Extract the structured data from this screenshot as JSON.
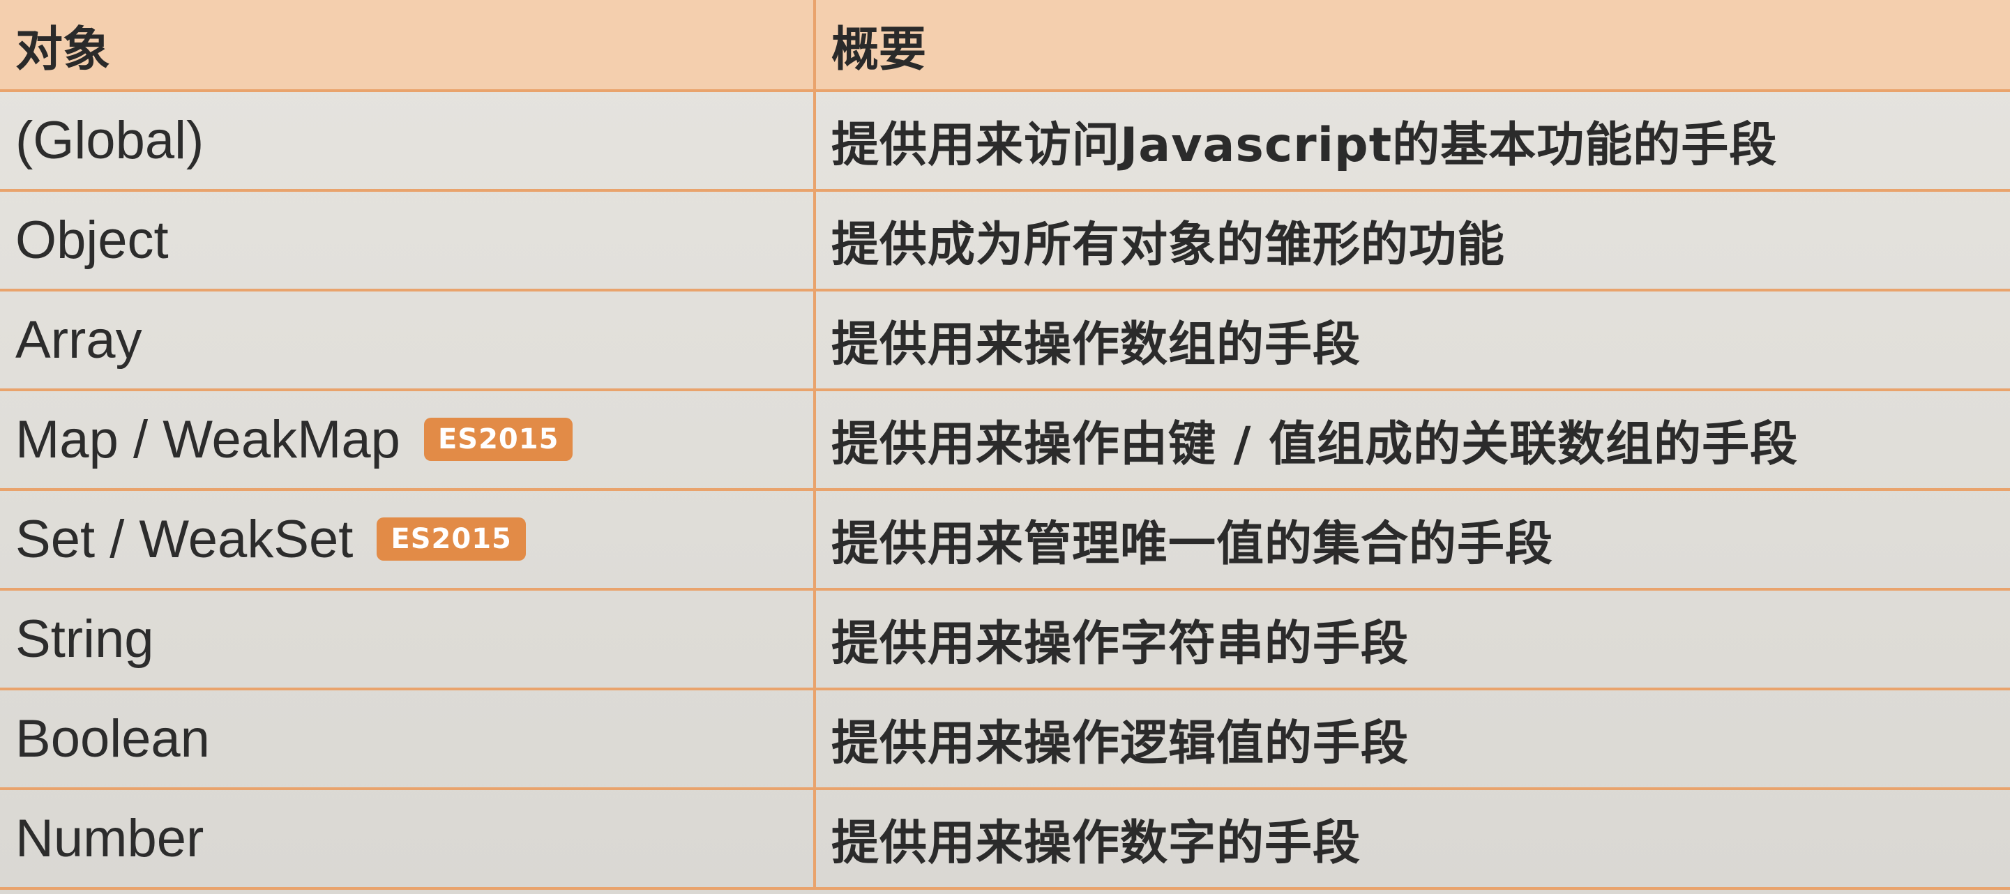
{
  "table": {
    "headers": [
      "对象",
      "概要"
    ],
    "rows": [
      {
        "name": "(Global)",
        "badge": "",
        "summary": "提供用来访问Javascript的基本功能的手段"
      },
      {
        "name": "Object",
        "badge": "",
        "summary": "提供成为所有对象的雏形的功能"
      },
      {
        "name": "Array",
        "badge": "",
        "summary": "提供用来操作数组的手段"
      },
      {
        "name": "Map / WeakMap",
        "badge": "ES2015",
        "summary": "提供用来操作由键 / 值组成的关联数组的手段"
      },
      {
        "name": "Set / WeakSet",
        "badge": "ES2015",
        "summary": "提供用来管理唯一值的集合的手段"
      },
      {
        "name": "String",
        "badge": "",
        "summary": "提供用来操作字符串的手段"
      },
      {
        "name": "Boolean",
        "badge": "",
        "summary": "提供用来操作逻辑值的手段"
      },
      {
        "name": "Number",
        "badge": "",
        "summary": "提供用来操作数字的手段"
      }
    ]
  },
  "colors": {
    "header_bg": "#f4cfae",
    "border": "#e9a36c",
    "badge_bg": "#e28b47"
  }
}
